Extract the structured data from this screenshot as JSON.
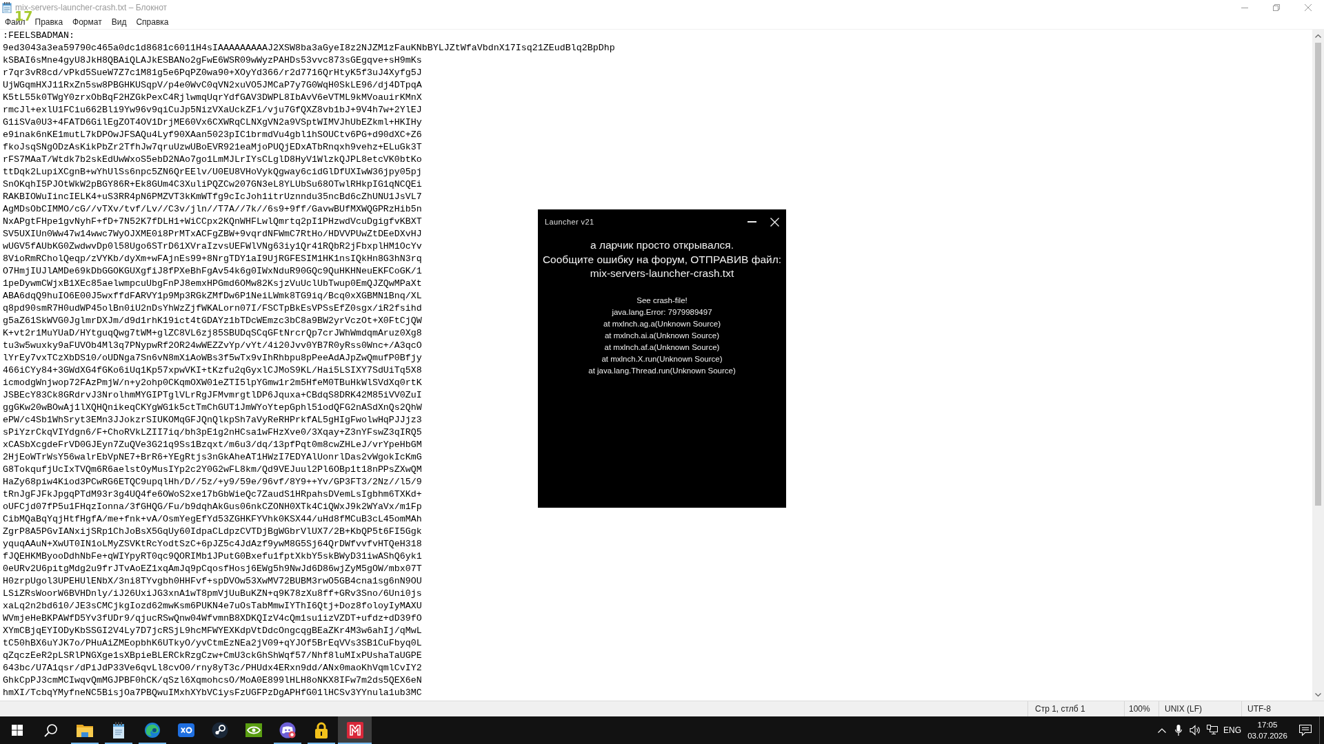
{
  "window": {
    "title": "mix-servers-launcher-crash.txt – Блокнот"
  },
  "fps_counter": "17",
  "menu": [
    "Файл",
    "Правка",
    "Формат",
    "Вид",
    "Справка"
  ],
  "editor": {
    "lines": [
      ":FEELSBADMAN:",
      "9ed3043a3ea59790c465a0dc1d8681c6011H4sIAAAAAAAAAJ2XSW8ba3aGyeI8z2NJZM1zFauKNbBYLJZtWfaVbdnX17Isq21ZEudBlq2BpDhp",
      "kSBAI6sMne4gyU8JkH8QBAiQLAJkESBANo2gFwE6WSR09wWyzPAHDs53vvc873sGEgqve+sH9mKs",
      "r7qr3vR8cd/vPkd5SueW7Z7c1M81g5e6PqPZ0wa90+XOyYd366/r2d7716QrHtyK5f3uJ4Xyfg5J",
      "UjWGqmHXJ11RxZn5sw8PBGHKUSqpV/p4e0WvC0qVN2xuVO5JMCaP7y7G0WqH0SkLE96/dj4DTpqA",
      "K5tL55k0TWgY0zrxObBqF2HZGkPexC4RjlwmqUqrYdfGAV3DWPL8IbAvV6eVTML9kMVoauirKMnX",
      "rmcJl+exlU1FCiu662Bli9Yw96v9qiCuJp5NizVXaUckZFi/vju7GfQXZ8vb1bJ+9V4h7w+2YlEJ",
      "G1iSVa0U3+4FATD6GilEgZOT4OV1DrjME60Vx6CXWRqCLNXgVN2a9VSptWIMVJhUbEZkml+HKIHy",
      "e9inak6nKE1mutL7kDPOwJFSAQu4Lyf90XAan5023pIC1brmdVu4gbl1hSOUCtv6PG+d90dXC+Z6",
      "fkoJsqSNgODzAsKikPbZr2TfhJw7qruUzwUBoEVR921eaMjoPUQjEDxATbRnqxh9vehz+ELuGk3T",
      "rFS7MAaT/Wtdk7b2skEdUwWxoS5ebD2NAo7go1LmMJLrIYsCLglD8HyV1WlzkQJPL8etcVK0btKo",
      "ttDqk2LupiXCgnB+wYhUlSs6npc5ZN6QrEElv/U0EU8VHoVykQgway6cidGlDfUXIwW36jpy05pj",
      "SnOKqhI5PJOtWkW2pBGY86R+Ek8GUm4C3XuliPQZCw207GN3eL8YLUbSu68OTwlRHkpIG1qNCQEi",
      "RAKBIOWuIincIELK4+uS3RR4pN6PMZVT3kKmWTfg9cIcJoh1itrUznndu35ncBd6cZhUNU1JsVL7",
      "AgMDsObCIMMO/cG//vTXv/tvf/Lv//C3v/jln//T7A//7k//6s9+9ff/GavwBUfMXWQGPRzHib5n",
      "NxAPgtFHpe1gvNyhF+fD+7N52K7fDLH1+WiCCpx2KQnWHFLwlQmrtq2pI1PHzwdVcuDgigfvKBXT",
      "SV5UXIUn0Ww47w14wwc7WyOJXME0i8PrMTxACFgZBW+9vqrdNFWmC7RtHo/HDVVPUwZtDEeDXvHJ",
      "wUGV5fAUbKG0ZwdwvDp0l58Ugo6STrD61XVraIzvsUEFWlVNg63iy1Qr41RQbR2jFbxplHM1OcYv",
      "8VioRmRCholQeqp/zVYKb/dyXm+wFAjnEs99+8NrgTDY1aI9UjRGFESIM1HK1nsIQkHn8G3hN3rq",
      "O7HmjIUJlAMDe69kDbGGOKGUXgfiJ8fPXeBhFgAv54k6g0IWxNduR90GQc9QuHKHNeuEKFCoGK/1",
      "1peDywmCWjxB1XEc85aelwmpcuUbgFnPJ8emxHPGmd6OMw82KsjzVuUclUbTwup0EmQJZQwMPaXt",
      "ABA6dqQ9huIO6E00J5wxffdFARVY1p9Mp3RGkZMfDw6P1NeiLWmk8TG9iq/Bcq0xXGBMN1Bnq/XL",
      "q8pd90smR7H0udWP45olBn0iU2nDsYhWzZjfWKALorn07I/FSCTpBkEsVPSsEfZ0sgx/iR2fsihd",
      "g5aZ61SkWVG0JglmrDXJm/d9d1rhK19ict4tGDAYz1bTDcWEmzc3bC8a9BW2yrVczOt+X0FtCjQW",
      "K+vt2r1MuYUaD/HYtguqQwg7tWM+glZC8VL6zj85SBUDqSCqGFtNrcrQp7crJWhWmdqmAruz0Xg8",
      "tu3w5wuxky9aFUVOb4Ml3q7PNypwRf2OR24wWEZZvYp/vYt/4i20Jvv0YB7R0yRss0Wnc+/A3qcO",
      "lYrEy7vxTCzXbDS10/oUDNga7Sn6vN8mXiAoWBs3f5wTx9vIhRhbpu8pPeeAdAJpZwQmufP0Bfjy",
      "466iCYy84+3GWdXG4fGKo6iUq1Kp57xpwVKI+tKzfu2qGyxlCJMoS9KL/Hai5LSIXY7SdUiTq5X8",
      "icmodgWnjwop72FAzPmjW/n+y2ohp0CKqmOXW01eZTI5lpYGmw1r2m5HfeM0TBuHkWlSVdXq0rtK",
      "JSBEcY83Ck8GRdrvJ3NrolhmMYGIPTglVLrRgJFMvmrgtlDP6Jquxa+CBdqS8DRK42M85iVV0ZuI",
      "ggGKw20wBOwAj1lXQHQnikeqCKYgWG1k5ctTmChGUT1JmWYoYtepGphl51odQFG2nASdXnQs2QhW",
      "ePW/c4Sb1WhSryt3EMn3JJokzrSIUKOMqGFJQnQlkpSh7aVyReRHPrkfAL5gHIgFwolwHqPJJjz3",
      "sPiYzrCkqVIYdgn6/F+ChoRVkLZII7iq/bh3pE1g2nHCsa1wFHzXve0/3Xqay+Z3nYFswZ3qIRQ5",
      "xCASbXcgdeFrVD0GJEyn7ZuQVe3G21q9Ss1Bzqxt/m6u3/dq/13pfPqt0m8cwZHLeJ/vrYpeHbGM",
      "2HjEoWTrWsY56walrEbVpNE7+BrR6+YEgRtjs3nGkAheAT1HWzI7EDYAlUonrlDas2vWgokIcKmG",
      "G8TokqufjUcIxTVQm6R6aelstOyMusIYp2c2Y0G2wFL8km/Qd9VEJuul2Pl6OBp1t18nPPsZXwQM",
      "HaZy68piw4Kiod3PCwRG6ETQC9upqlHh/D//5z/+y9/59e/96vf/8Y9++Yv/GP3FT3/2Nz//l5/9",
      "tRnJgFJFkJpgqPTdM93r3g4UQ4fe6OWoS2xe17bGbWieQc7ZaudS1HRpahsDVemLsIgbhm6TXKd+",
      "oUFCjd07fP5u1FHqzIonna/3fGHQG/Fu/b9dqhAkGus06nkCZONH0XTk4CiQWxJ9k2WYaVx/m1Fp",
      "CibMQaBqYqjHtfHgfA/me+fnk+vA/OsmYegEfYd53ZGHKFYVhk0KSX44/uHd8fMCuB3cL45omMAh",
      "ZgrP8A5PGvIANxijSRp1ChJoBsX5GqUy60IdpaCLdpzCVTDjBgWGbrVlUX7/2B+KbQP5t6FI5Ggk",
      "yquqAAuN+XwUT0IN1oLMyZSVKtRcYodtSzC+6pJZ5c4JdAzf9ywM8G5Sj64QrDWfvvfvHTQeH318",
      "fJQEHKMByooDdhNbFe+qWIYpyRT0qc9QORIMb1JPutG0Bxefu1fptXkbY5skBWyD31iwAShQ6yk1",
      "0eURv2U6pitgMdg2u9frJTvAoEZ1xqAmJq9pCqosfHosj6EWg5h9NwJd6D86wjZyM5gOW/mbx07T",
      "H0zrpUgol3UPEHUlENbX/3ni8TYvgbh0HHFvf+spDVOw53XwMV72BUBM3rwO5GB4cna1sg6nN9OU",
      "LSiZRsWoorW6BVHDnly/iJ26UxiJG3xnA1wT8pmVjUuBuKZN+q9K78zXu8ff+GRv3Sno/6Uni0js",
      "xaLq2n2bd610/JE3sCMCjkgIozd62mwKsm6PUKN4e7uOsTabMmwIYThI6Qtj+Doz8foloyIyMAXU",
      "WVmjeHeBKPAWfD5Yv3fUDr9/qjucRSwQnw04WfvmnB8XDKQIzV4cQm1su1izVZDT+ufdz+dD39fO",
      "XYmCBjqEYIODyKbSSGI2V4Ly7D7jcRSjL9hcMFWYEXKdpVtDdcOngcqgBEaZKr4M3w6ahIj/qMwL",
      "tC50hBX6uYJK7o/PHuAiZMEopbhK6UTkyO/yvCtmEzNEa2jV09+qYJOf5BrEqVVs3SB1CuFbyq0L",
      "qZqczEeR2pLSRlPNGXge1sXBpieBLERCkRzgCzw+CmU3ckGhShWqf57/Nhf8luMIxPUshaTaUGPE",
      "643bc/U7A1qsr/dPiJdP33Ve6qvLl8cvO0/rny8yT3c/PHUdx4ERxn9dd/ANx0maoKhVqmlCvIY2",
      "GhkCpPJ3cmMCIwqvQmMGJPBF0hCK/qSzl6XqmohcsO/MoA0E899lHLH8oNKX8IFw7m2ds5QEX6eN",
      "hmXI/TcbqYMyfneNC5BisjOa7PBQwuIMxhXYbVCiysFzUGFPzDgAPHfG01lHCSv3YYnula1ub3MC"
    ]
  },
  "status_bar": {
    "position": "Стр 1, стлб 1",
    "zoom": "100%",
    "line_endings": "UNIX (LF)",
    "encoding": "UTF-8"
  },
  "dialog": {
    "title": "Launcher v21",
    "message": [
      "а ларчик просто открывался.",
      "Сообщите ошибку на форум, ОТПРАВИВ файл:",
      "mix-servers-launcher-crash.txt"
    ],
    "details": [
      "See crash-file!",
      "java.lang.Error: 7979989497",
      "at mxlnch.ag.a(Unknown Source)",
      "at mxlnch.ai.a(Unknown Source)",
      "at mxlnch.af.a(Unknown Source)",
      "at mxlnch.X.run(Unknown Source)",
      "at java.lang.Thread.run(Unknown Source)"
    ]
  },
  "taskbar": {
    "apps": [
      {
        "kind": "start",
        "running": false,
        "selected": false
      },
      {
        "kind": "search",
        "running": false,
        "selected": false
      },
      {
        "kind": "folder",
        "running": true,
        "selected": false
      },
      {
        "kind": "notepad",
        "running": true,
        "selected": false
      },
      {
        "kind": "browser",
        "running": true,
        "selected": false
      },
      {
        "kind": "gamepad",
        "running": false,
        "selected": false
      },
      {
        "kind": "disc",
        "running": false,
        "selected": false
      },
      {
        "kind": "eye",
        "running": false,
        "selected": false
      },
      {
        "kind": "chat",
        "running": true,
        "selected": false
      },
      {
        "kind": "padlock",
        "running": true,
        "selected": false
      },
      {
        "kind": "launcher",
        "running": true,
        "selected": true
      }
    ],
    "tray": {
      "language": "ENG",
      "time": "17:05",
      "date": "03.07.2026"
    }
  }
}
